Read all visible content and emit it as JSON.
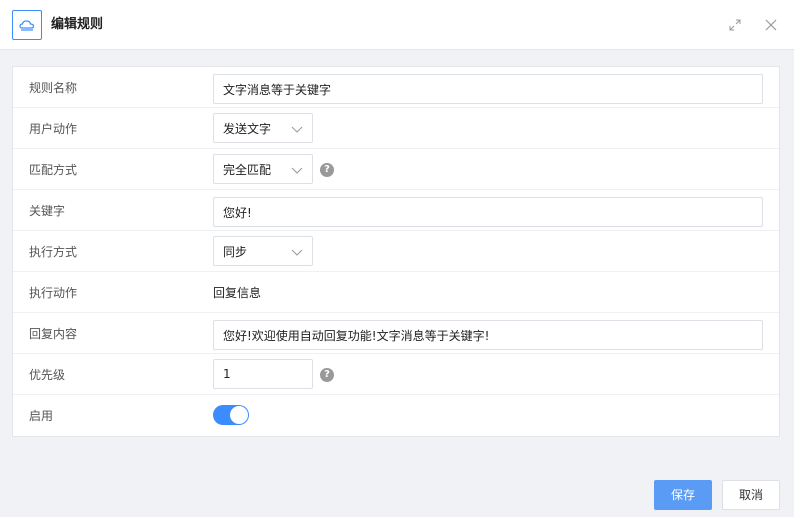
{
  "header": {
    "title": "编辑规则",
    "logo_icon": "cloud-icon",
    "maximize_icon": "expand-icon",
    "close_icon": "close-icon"
  },
  "form": {
    "rule_name": {
      "label": "规则名称",
      "value": "文字消息等于关键字"
    },
    "user_action": {
      "label": "用户动作",
      "value": "发送文字"
    },
    "match_mode": {
      "label": "匹配方式",
      "value": "完全匹配",
      "help": "?"
    },
    "keyword": {
      "label": "关键字",
      "value": "您好!"
    },
    "exec_mode": {
      "label": "执行方式",
      "value": "同步"
    },
    "exec_action": {
      "label": "执行动作",
      "value": "回复信息"
    },
    "reply_content": {
      "label": "回复内容",
      "value": "您好!欢迎使用自动回复功能!文字消息等于关键字!"
    },
    "priority": {
      "label": "优先级",
      "value": "1",
      "help": "?"
    },
    "enabled": {
      "label": "启用",
      "on": true
    }
  },
  "footer": {
    "save_label": "保存",
    "cancel_label": "取消"
  },
  "colors": {
    "primary": "#3b8cff",
    "save_button": "#5a9cf5",
    "background": "#f0f2f5"
  }
}
